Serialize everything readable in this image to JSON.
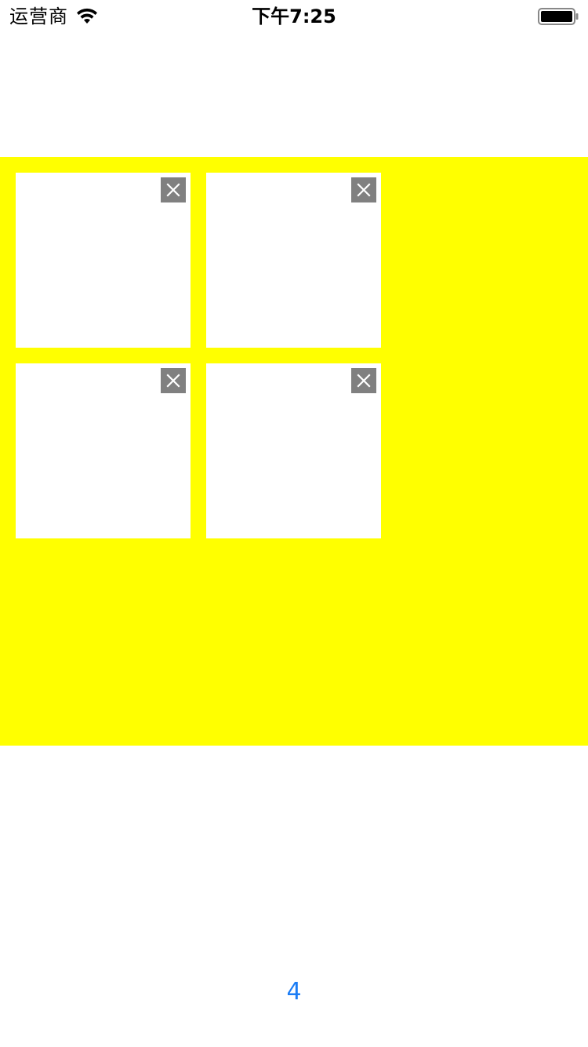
{
  "status_bar": {
    "carrier": "运营商",
    "time": "下午7:25",
    "wifi_icon": "wifi-icon",
    "battery_icon": "battery-icon"
  },
  "photo_area": {
    "background_color": "#ffff00",
    "tiles": [
      {
        "close_icon": "close-icon"
      },
      {
        "close_icon": "close-icon"
      },
      {
        "close_icon": "close-icon"
      },
      {
        "close_icon": "close-icon"
      }
    ]
  },
  "footer": {
    "count_label": "4",
    "accent_color": "#1a7cf5"
  }
}
